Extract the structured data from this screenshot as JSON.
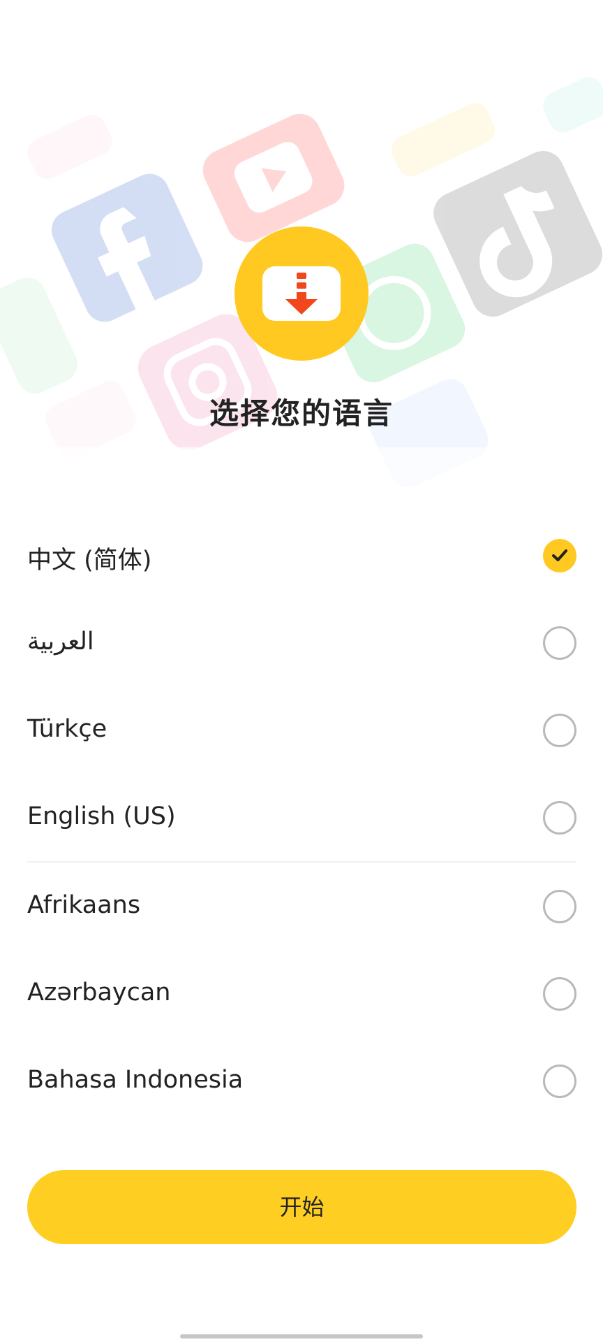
{
  "header": {
    "title": "选择您的语言"
  },
  "languages": [
    {
      "label": "中文 (简体)",
      "selected": true
    },
    {
      "label": "العربية",
      "selected": false
    },
    {
      "label": "Türkçe",
      "selected": false
    },
    {
      "label": "English (US)",
      "selected": false
    },
    {
      "label": "Afrikaans",
      "selected": false
    },
    {
      "label": "Azərbaycan",
      "selected": false
    },
    {
      "label": "Bahasa Indonesia",
      "selected": false
    }
  ],
  "start_button": {
    "label": "开始"
  },
  "colors": {
    "accent": "#FFC922",
    "logo_arrow": "#F2461C",
    "radio_border": "#B9B9B9",
    "text": "#222222"
  },
  "icons": {
    "logo": "download-arrow-icon",
    "selected": "check-icon",
    "background": [
      "facebook-icon",
      "youtube-icon",
      "tiktok-icon",
      "whatsapp-icon",
      "instagram-icon"
    ]
  }
}
